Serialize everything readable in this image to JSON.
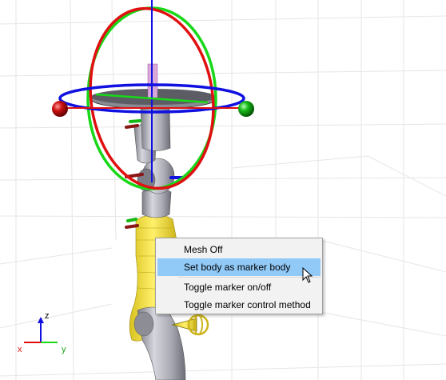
{
  "context_menu": {
    "items": [
      {
        "label": "Mesh Off",
        "highlighted": false
      },
      {
        "label": "Set body as marker body",
        "highlighted": true
      },
      {
        "label": "Toggle marker on/off",
        "highlighted": false
      },
      {
        "label": "Toggle marker control method",
        "highlighted": false
      }
    ]
  },
  "axes_triad": {
    "z": "z",
    "x": "x",
    "y": "y"
  },
  "colors": {
    "x_axis": "#e01010",
    "y_axis": "#18d818",
    "z_axis": "#1010e0",
    "robot_body": "#b9b9c2",
    "selected_link": "#f4df34",
    "highlight": "#91c9f7"
  }
}
